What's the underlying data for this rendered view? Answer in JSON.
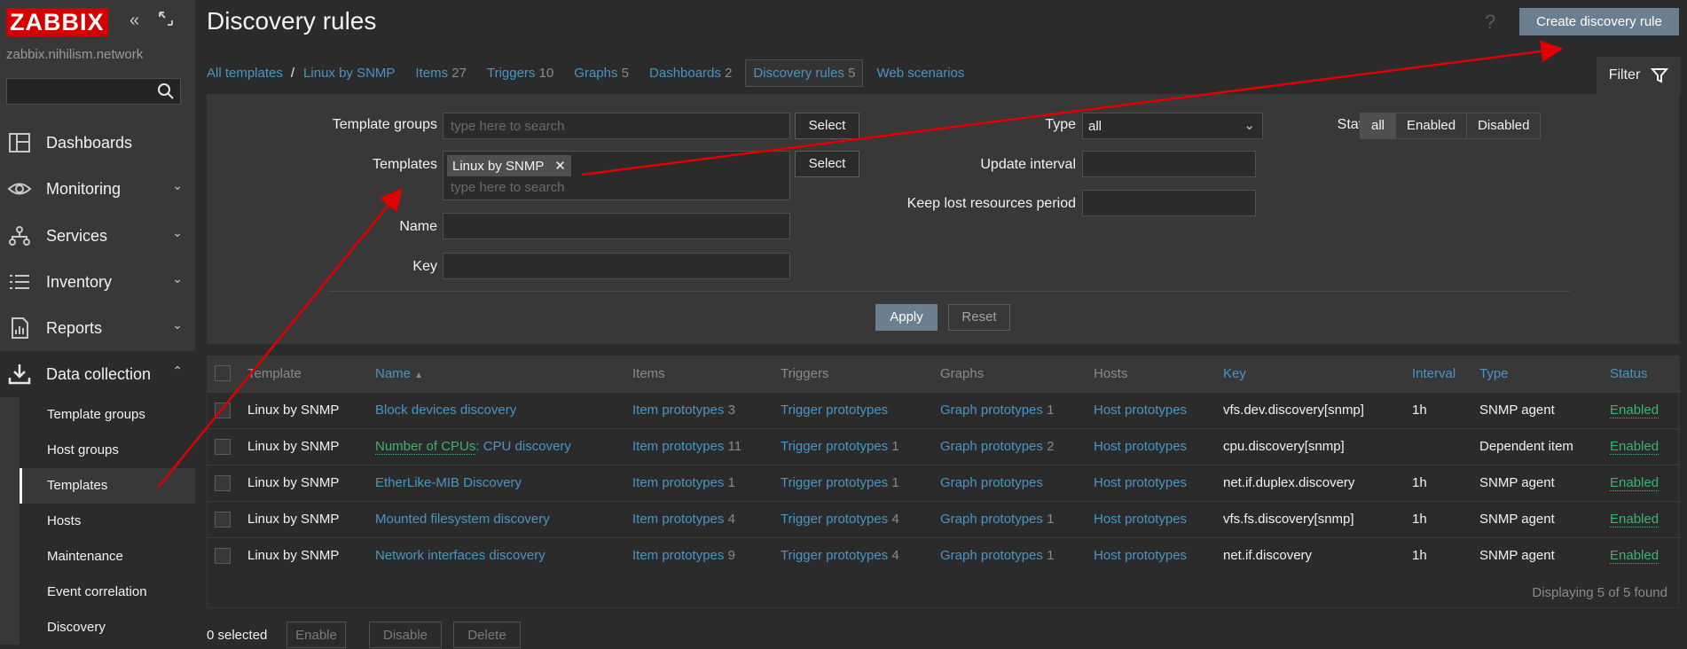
{
  "sidebar": {
    "logo": "ZABBIX",
    "server": "zabbix.nihilism.network",
    "menu": [
      {
        "label": "Dashboards",
        "icon": "dashboard-icon"
      },
      {
        "label": "Monitoring",
        "icon": "eye-icon"
      },
      {
        "label": "Services",
        "icon": "services-icon"
      },
      {
        "label": "Inventory",
        "icon": "list-icon"
      },
      {
        "label": "Reports",
        "icon": "reports-icon"
      },
      {
        "label": "Data collection",
        "icon": "download-icon"
      }
    ],
    "submenu": [
      "Template groups",
      "Host groups",
      "Templates",
      "Hosts",
      "Maintenance",
      "Event correlation",
      "Discovery"
    ]
  },
  "header": {
    "title": "Discovery rules",
    "help": "?",
    "create_label": "Create discovery rule"
  },
  "tabs": {
    "all_templates": "All templates",
    "separator": "/",
    "template": "Linux by SNMP",
    "items": {
      "label": "Items",
      "count": "27"
    },
    "triggers": {
      "label": "Triggers",
      "count": "10"
    },
    "graphs": {
      "label": "Graphs",
      "count": "5"
    },
    "dashboards": {
      "label": "Dashboards",
      "count": "2"
    },
    "discovery": {
      "label": "Discovery rules",
      "count": "5"
    },
    "web": "Web scenarios",
    "filter": "Filter"
  },
  "filter": {
    "template_groups_label": "Template groups",
    "templates_label": "Templates",
    "name_label": "Name",
    "key_label": "Key",
    "placeholder": "type here to search",
    "select_label": "Select",
    "template_chip": "Linux by SNMP",
    "chip_close": "✕",
    "type_label": "Type",
    "type_value": "all",
    "update_interval_label": "Update interval",
    "keep_lost_label": "Keep lost resources period",
    "status_label": "Status",
    "status_options": [
      "all",
      "Enabled",
      "Disabled"
    ],
    "apply_label": "Apply",
    "reset_label": "Reset"
  },
  "table": {
    "headers": {
      "template": "Template",
      "name": "Name",
      "sort_arrow": "▲",
      "items": "Items",
      "triggers": "Triggers",
      "graphs": "Graphs",
      "hosts": "Hosts",
      "key": "Key",
      "interval": "Interval",
      "type": "Type",
      "status": "Status"
    },
    "rows": [
      {
        "template": "Linux by SNMP",
        "name_prefix": "",
        "name": "Block devices discovery",
        "items": "Item prototypes",
        "items_count": "3",
        "triggers": "Trigger prototypes",
        "triggers_count": "",
        "graphs": "Graph prototypes",
        "graphs_count": "1",
        "hosts": "Host prototypes",
        "key": "vfs.dev.discovery[snmp]",
        "interval": "1h",
        "type": "SNMP agent",
        "status": "Enabled"
      },
      {
        "template": "Linux by SNMP",
        "name_prefix": "Number of CPUs",
        "name": ": CPU discovery",
        "items": "Item prototypes",
        "items_count": "11",
        "triggers": "Trigger prototypes",
        "triggers_count": "1",
        "graphs": "Graph prototypes",
        "graphs_count": "2",
        "hosts": "Host prototypes",
        "key": "cpu.discovery[snmp]",
        "interval": "",
        "type": "Dependent item",
        "status": "Enabled"
      },
      {
        "template": "Linux by SNMP",
        "name_prefix": "",
        "name": "EtherLike-MIB Discovery",
        "items": "Item prototypes",
        "items_count": "1",
        "triggers": "Trigger prototypes",
        "triggers_count": "1",
        "graphs": "Graph prototypes",
        "graphs_count": "",
        "hosts": "Host prototypes",
        "key": "net.if.duplex.discovery",
        "interval": "1h",
        "type": "SNMP agent",
        "status": "Enabled"
      },
      {
        "template": "Linux by SNMP",
        "name_prefix": "",
        "name": "Mounted filesystem discovery",
        "items": "Item prototypes",
        "items_count": "4",
        "triggers": "Trigger prototypes",
        "triggers_count": "4",
        "graphs": "Graph prototypes",
        "graphs_count": "1",
        "hosts": "Host prototypes",
        "key": "vfs.fs.discovery[snmp]",
        "interval": "1h",
        "type": "SNMP agent",
        "status": "Enabled"
      },
      {
        "template": "Linux by SNMP",
        "name_prefix": "",
        "name": "Network interfaces discovery",
        "items": "Item prototypes",
        "items_count": "9",
        "triggers": "Trigger prototypes",
        "triggers_count": "4",
        "graphs": "Graph prototypes",
        "graphs_count": "1",
        "hosts": "Host prototypes",
        "key": "net.if.discovery",
        "interval": "1h",
        "type": "SNMP agent",
        "status": "Enabled"
      }
    ],
    "display_count": "Displaying 5 of 5 found"
  },
  "actions": {
    "selected": "0 selected",
    "enable": "Enable",
    "disable": "Disable",
    "delete": "Delete"
  },
  "colors": {
    "arrow": "#e00000",
    "link": "#4796c4",
    "enabled": "#3cb371",
    "logo": "#d40000"
  }
}
